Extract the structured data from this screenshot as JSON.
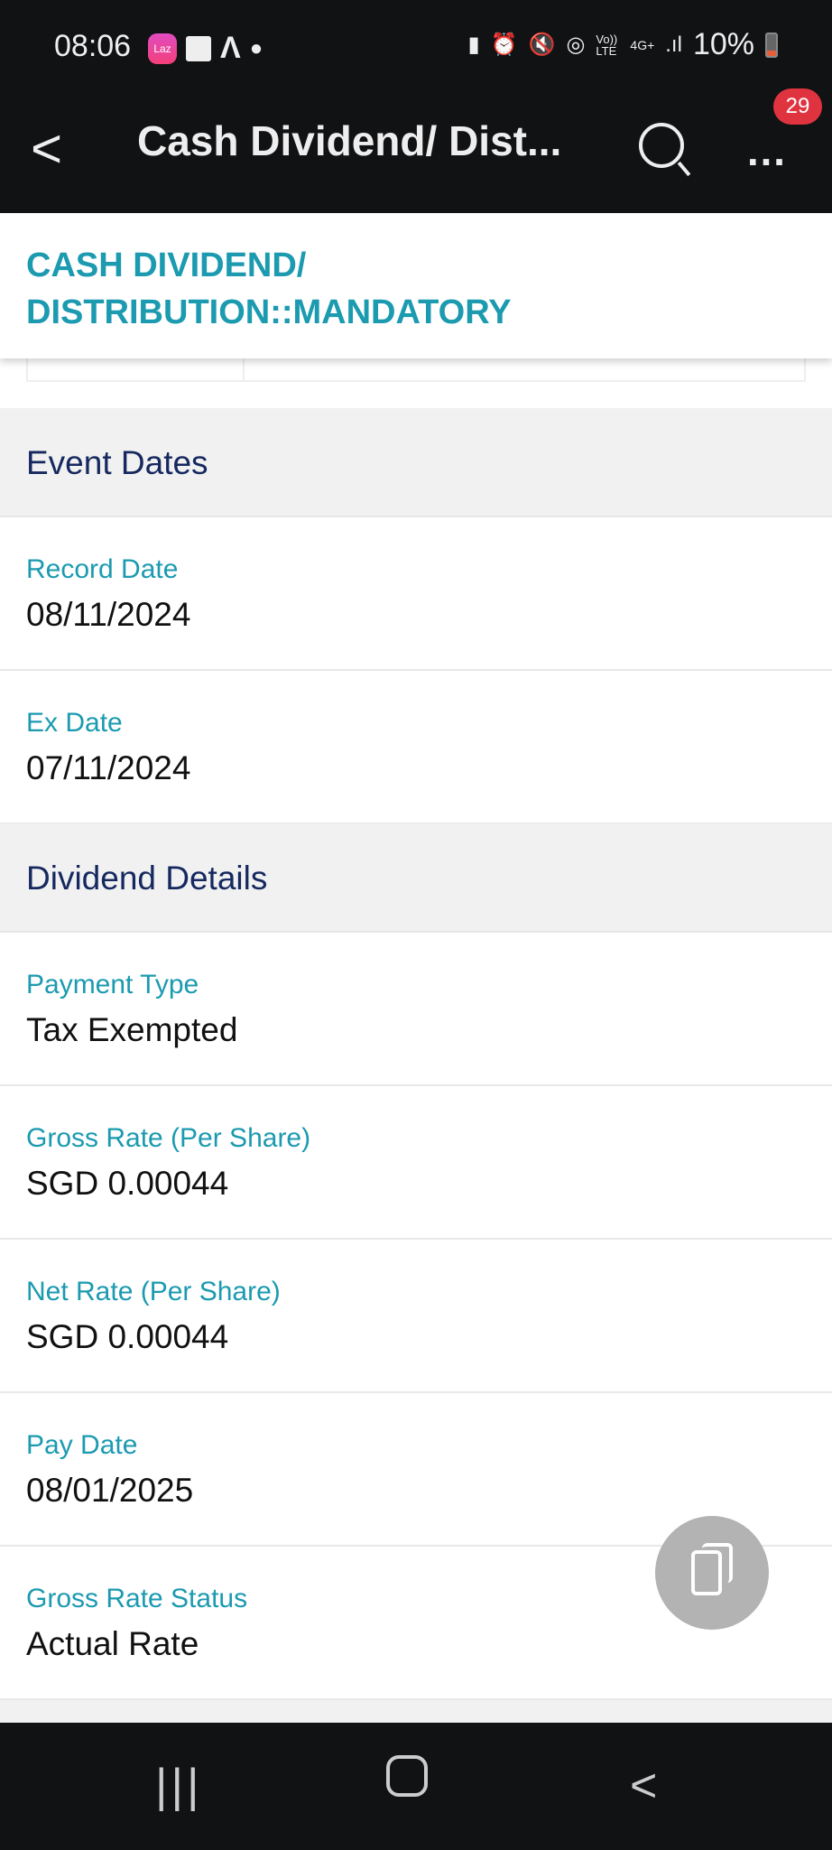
{
  "status_bar": {
    "time": "08:06",
    "battery": "10%",
    "network": "4G+",
    "volte": "Vo)) LTE",
    "laz_label": "Laz"
  },
  "app_bar": {
    "title": "Cash Dividend/ Dist...",
    "notification_count": "29",
    "more_label": "…"
  },
  "title_card": {
    "line1": "CASH DIVIDEND/",
    "line2": "DISTRIBUTION::MANDATORY"
  },
  "sections": [
    {
      "title": "Event Dates",
      "fields": [
        {
          "label": "Record Date",
          "value": "08/11/2024"
        },
        {
          "label": "Ex Date",
          "value": "07/11/2024"
        }
      ]
    },
    {
      "title": "Dividend Details",
      "fields": [
        {
          "label": "Payment Type",
          "value": "Tax Exempted"
        },
        {
          "label": "Gross Rate (Per Share)",
          "value": "SGD 0.00044"
        },
        {
          "label": "Net Rate (Per Share)",
          "value": "SGD 0.00044"
        },
        {
          "label": "Pay Date",
          "value": "08/01/2025"
        },
        {
          "label": "Gross Rate Status",
          "value": "Actual Rate"
        }
      ]
    }
  ],
  "colors": {
    "accent": "#1b9ab0",
    "section_title": "#15285f",
    "bar": "#111214",
    "badge": "#e03340"
  }
}
